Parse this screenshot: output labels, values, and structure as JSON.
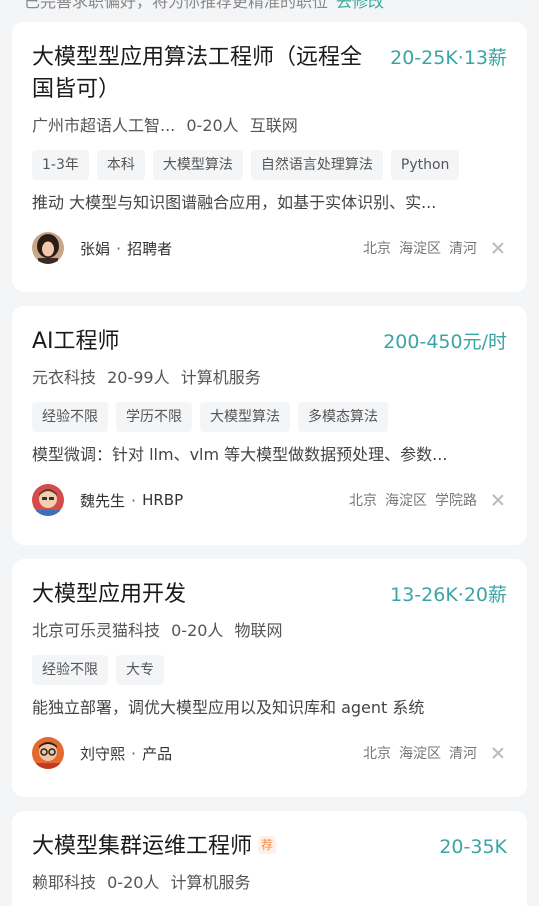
{
  "top_partial": {
    "text": "已完善求职偏好，将为你推荐更精准的职位",
    "link": "去修改"
  },
  "jobs": [
    {
      "title": "大模型型应用算法工程师（远程全国皆可）",
      "title_line1": "大模型型应用算法工程师（远程全",
      "title_line2": "国皆可）",
      "salary": "20-25K·13薪",
      "company": "广州市超语人工智...",
      "size": "0-20人",
      "industry": "互联网",
      "tags": [
        "1-3年",
        "本科",
        "大模型算法",
        "自然语言处理算法",
        "Python"
      ],
      "desc": "推动 大模型与知识图谱融合应用，如基于实体识别、实...",
      "recruiter": "张娟",
      "role": "招聘者",
      "locations": [
        "北京",
        "海淀区",
        "清河"
      ]
    },
    {
      "title": "AI工程师",
      "salary": "200-450元/时",
      "company": "元衣科技",
      "size": "20-99人",
      "industry": "计算机服务",
      "tags": [
        "经验不限",
        "学历不限",
        "大模型算法",
        "多模态算法"
      ],
      "desc": "模型微调：针对 llm、vlm 等大模型做数据预处理、参数...",
      "recruiter": "魏先生",
      "role": "HRBP",
      "locations": [
        "北京",
        "海淀区",
        "学院路"
      ]
    },
    {
      "title": "大模型应用开发",
      "salary": "13-26K·20薪",
      "company": "北京可乐灵猫科技",
      "size": "0-20人",
      "industry": "物联网",
      "tags": [
        "经验不限",
        "大专"
      ],
      "desc": "能独立部署，调优大模型应用以及知识库和 agent 系统",
      "recruiter": "刘守熙",
      "role": "产品",
      "locations": [
        "北京",
        "海淀区",
        "清河"
      ]
    },
    {
      "title": "大模型集群运维工程师",
      "badge": "荐",
      "salary": "20-35K",
      "company": "赖耶科技",
      "size": "0-20人",
      "industry": "计算机服务"
    }
  ],
  "colors": {
    "accent": "#3ba4a4",
    "badge": "#f08a4b",
    "background": "#f4f5f7"
  }
}
